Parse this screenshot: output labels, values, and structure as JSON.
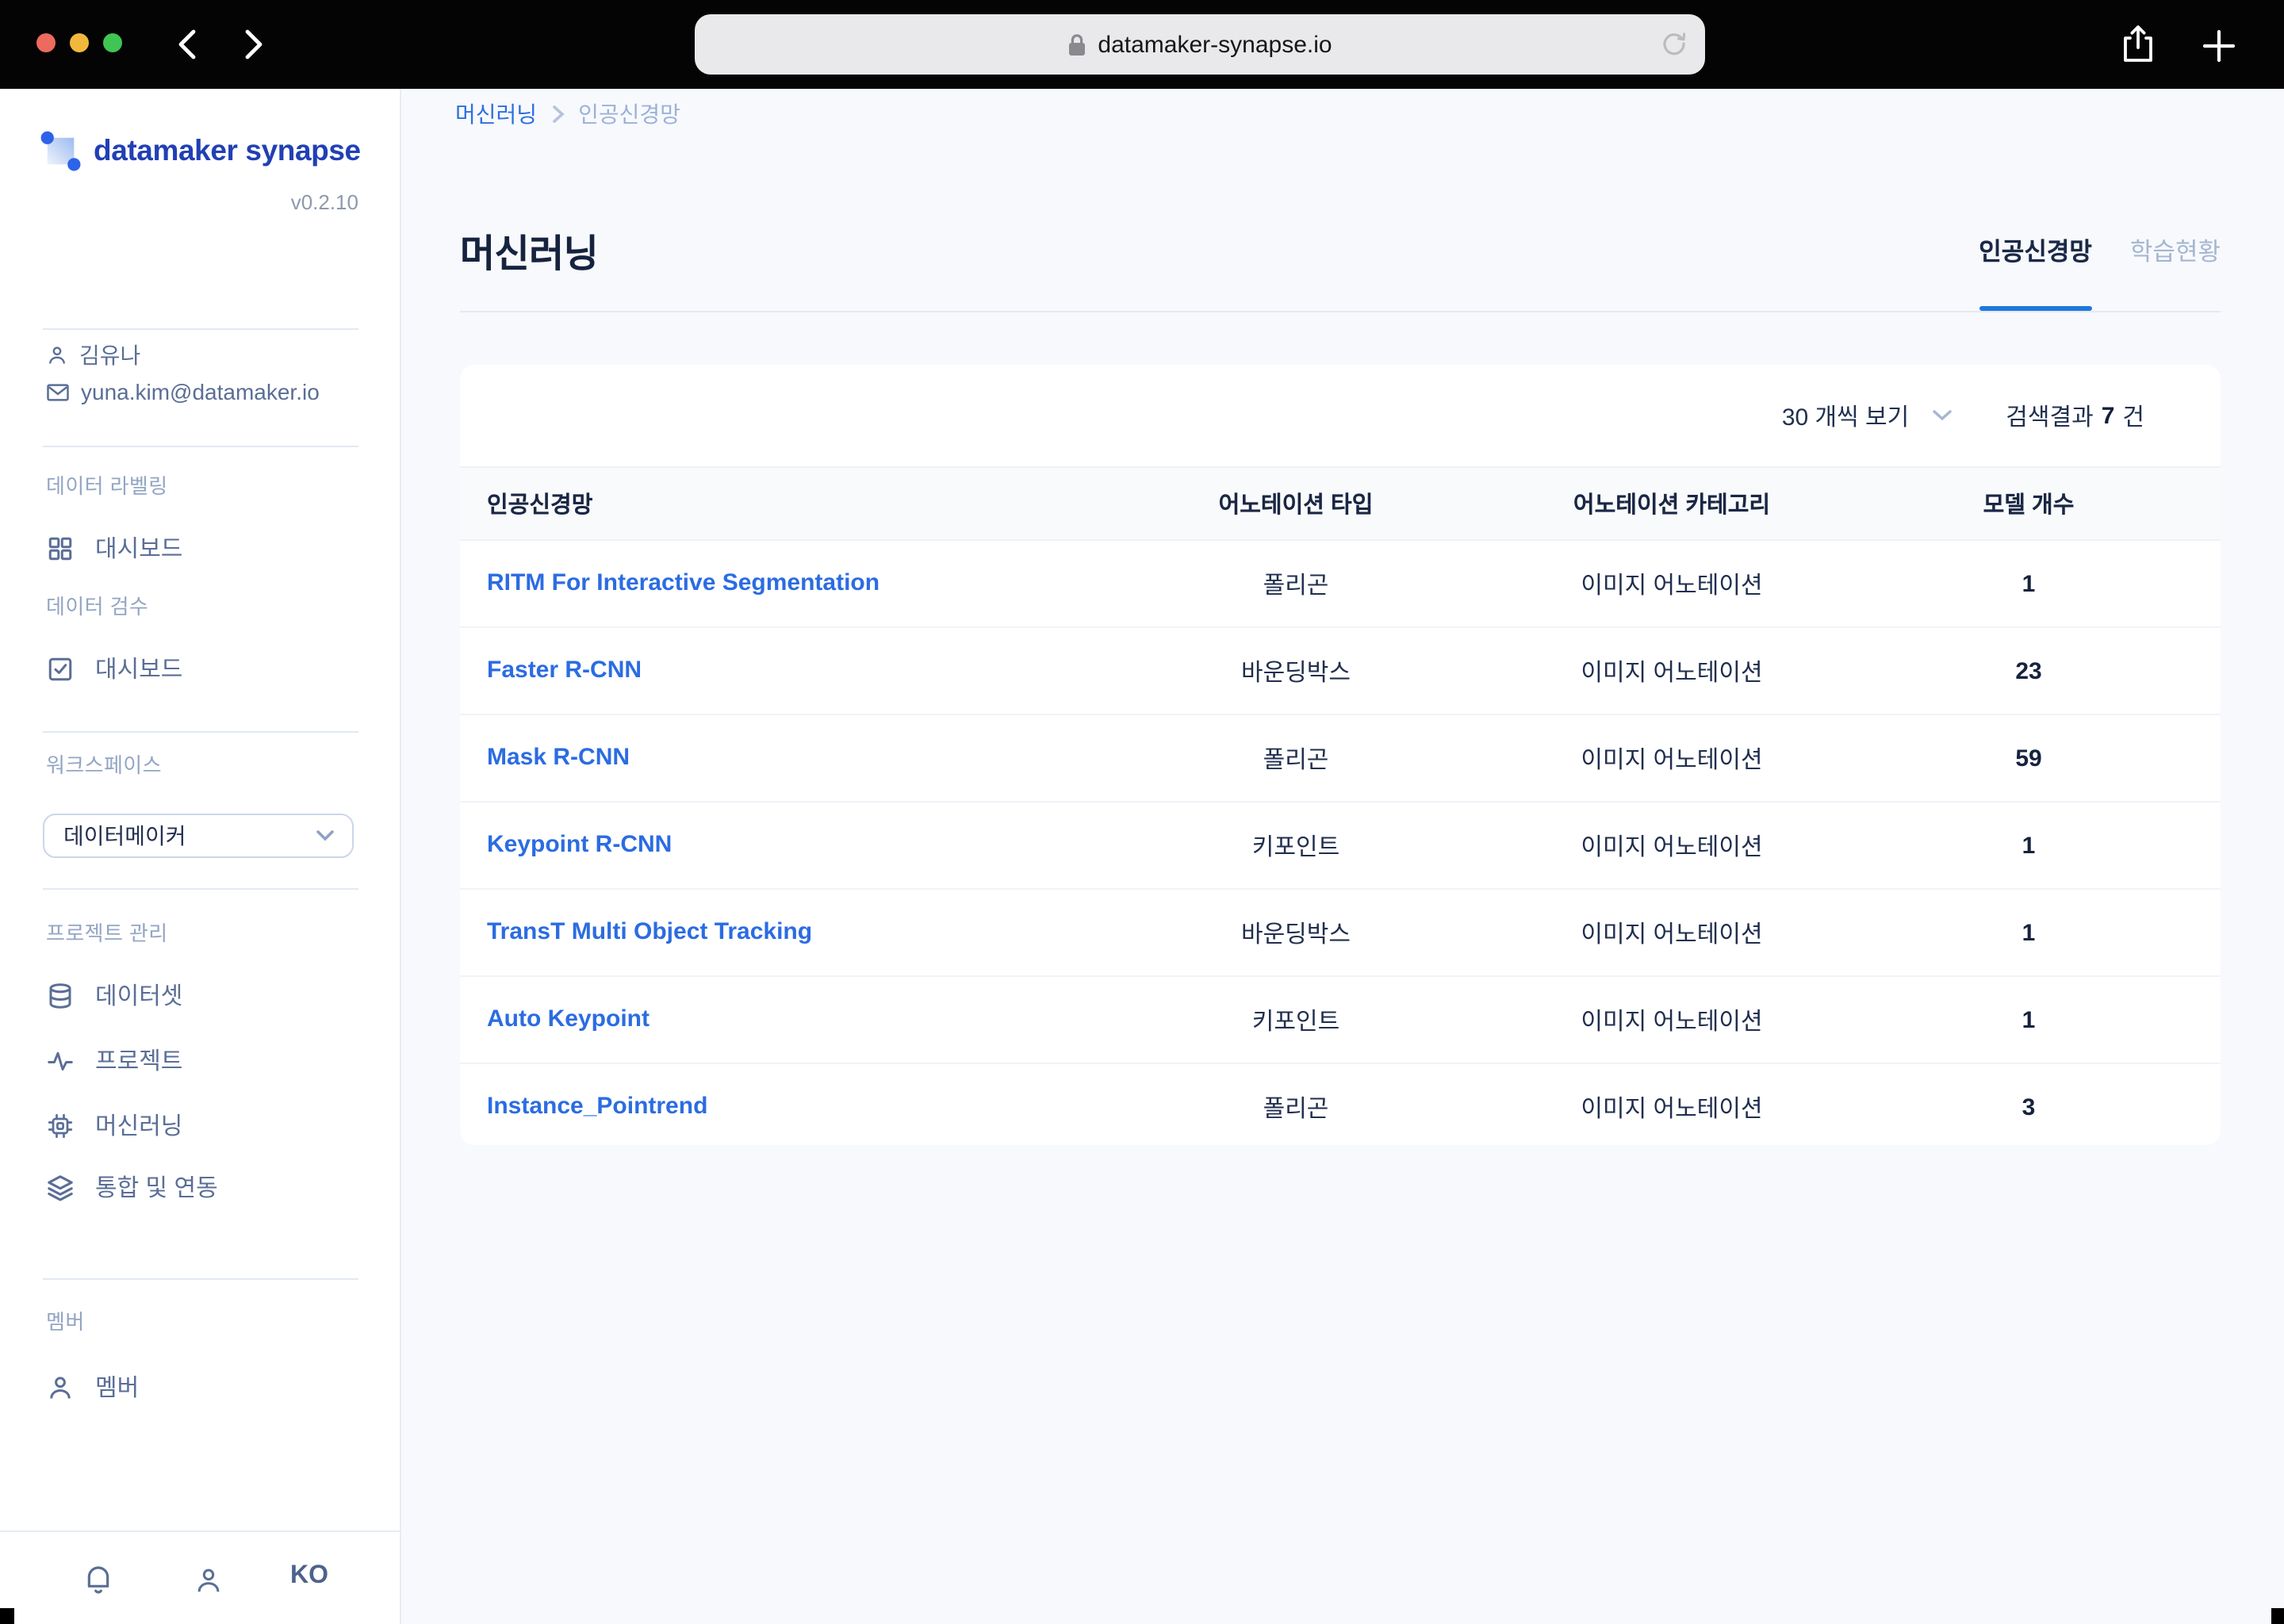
{
  "browser": {
    "url": "datamaker-synapse.io"
  },
  "sidebar": {
    "brand": "datamaker synapse",
    "version": "v0.2.10",
    "user": {
      "name": "김유나",
      "email": "yuna.kim@datamaker.io"
    },
    "section_labeling": {
      "label": "데이터 라벨링",
      "item": "대시보드"
    },
    "section_review": {
      "label": "데이터 검수",
      "item": "대시보드"
    },
    "workspace": {
      "label": "워크스페이스",
      "selected": "데이터메이커"
    },
    "section_project": {
      "label": "프로젝트 관리",
      "items": [
        {
          "label": "데이터셋",
          "icon": "database-icon"
        },
        {
          "label": "프로젝트",
          "icon": "activity-icon"
        },
        {
          "label": "머신러닝",
          "icon": "chip-icon"
        },
        {
          "label": "통합 및 연동",
          "icon": "layers-icon"
        }
      ]
    },
    "section_member": {
      "label": "멤버",
      "item": "멤버"
    },
    "footer": {
      "language": "KO"
    }
  },
  "main": {
    "breadcrumb": [
      "머신러닝",
      "인공신경망"
    ],
    "title": "머신러닝",
    "tabs": [
      {
        "label": "인공신경망",
        "active": true
      },
      {
        "label": "학습현황",
        "active": false
      }
    ],
    "controls": {
      "page_size": "30 개씩 보기",
      "result_prefix": "검색결과",
      "result_count": "7",
      "result_suffix": "건"
    },
    "table": {
      "columns": [
        "인공신경망",
        "어노테이션 타입",
        "어노테이션 카테고리",
        "모델 개수"
      ],
      "rows": [
        {
          "name": "RITM For Interactive Segmentation",
          "annotation_type": "폴리곤",
          "annotation_category": "이미지 어노테이션",
          "model_count": "1"
        },
        {
          "name": "Faster R-CNN",
          "annotation_type": "바운딩박스",
          "annotation_category": "이미지 어노테이션",
          "model_count": "23"
        },
        {
          "name": "Mask R-CNN",
          "annotation_type": "폴리곤",
          "annotation_category": "이미지 어노테이션",
          "model_count": "59"
        },
        {
          "name": "Keypoint R-CNN",
          "annotation_type": "키포인트",
          "annotation_category": "이미지 어노테이션",
          "model_count": "1"
        },
        {
          "name": "TransT Multi Object Tracking",
          "annotation_type": "바운딩박스",
          "annotation_category": "이미지 어노테이션",
          "model_count": "1"
        },
        {
          "name": "Auto Keypoint",
          "annotation_type": "키포인트",
          "annotation_category": "이미지 어노테이션",
          "model_count": "1"
        },
        {
          "name": "Instance_Pointrend",
          "annotation_type": "폴리곤",
          "annotation_category": "이미지 어노테이션",
          "model_count": "3"
        }
      ]
    }
  },
  "colors": {
    "brand_blue": "#2140b4",
    "dot_blue": "#2d63e8",
    "link_blue": "#2b6ce2",
    "breadcrumb_blue": "#2e6fe0",
    "tab_underline": "#1e79da",
    "title_navy": "#16233f",
    "sidebar_text": "#5a6e96",
    "section_label": "#93a5c4",
    "content_bg": "#f7f9fc",
    "traffic_red": "#ed6a5e",
    "traffic_yellow": "#f0b93c",
    "traffic_green": "#3fc553"
  }
}
